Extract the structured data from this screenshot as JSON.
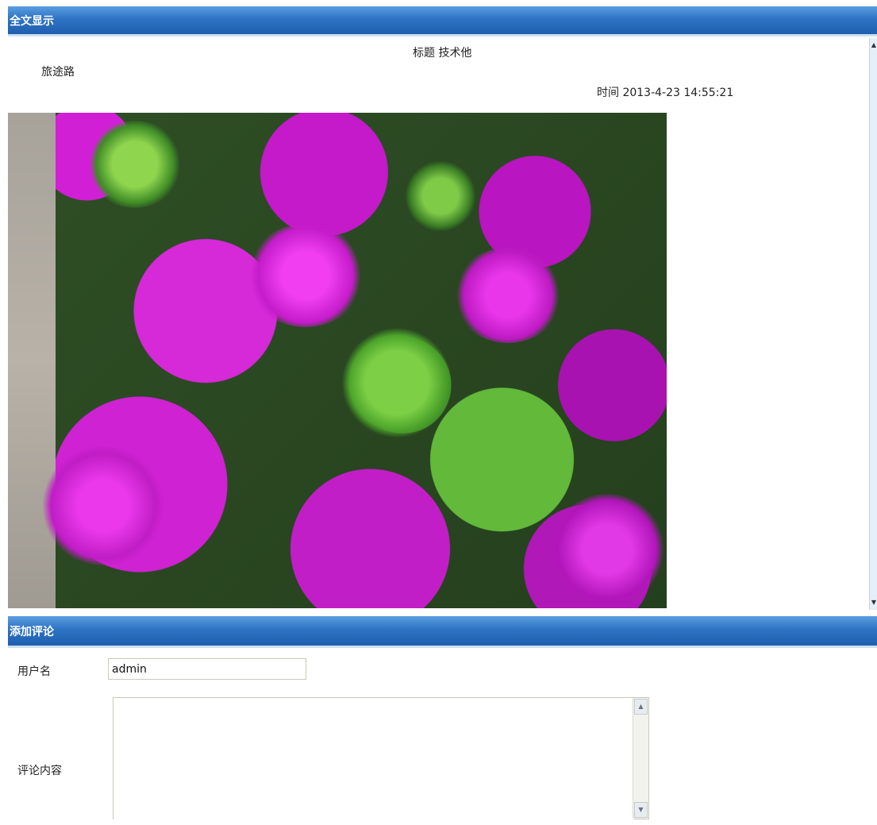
{
  "sections": {
    "full_text_title": "全文显示",
    "add_comment_title": "添加评论"
  },
  "article": {
    "title_line": "标题 技术他",
    "author": "旅途路",
    "time_line": "时间 2013-4-23 14:55:21"
  },
  "comment_form": {
    "username_label": "用户名",
    "username_value": "admin",
    "content_label": "评论内容",
    "content_value": ""
  },
  "icons": {
    "scroll_up": "▲",
    "scroll_down": "▼"
  }
}
